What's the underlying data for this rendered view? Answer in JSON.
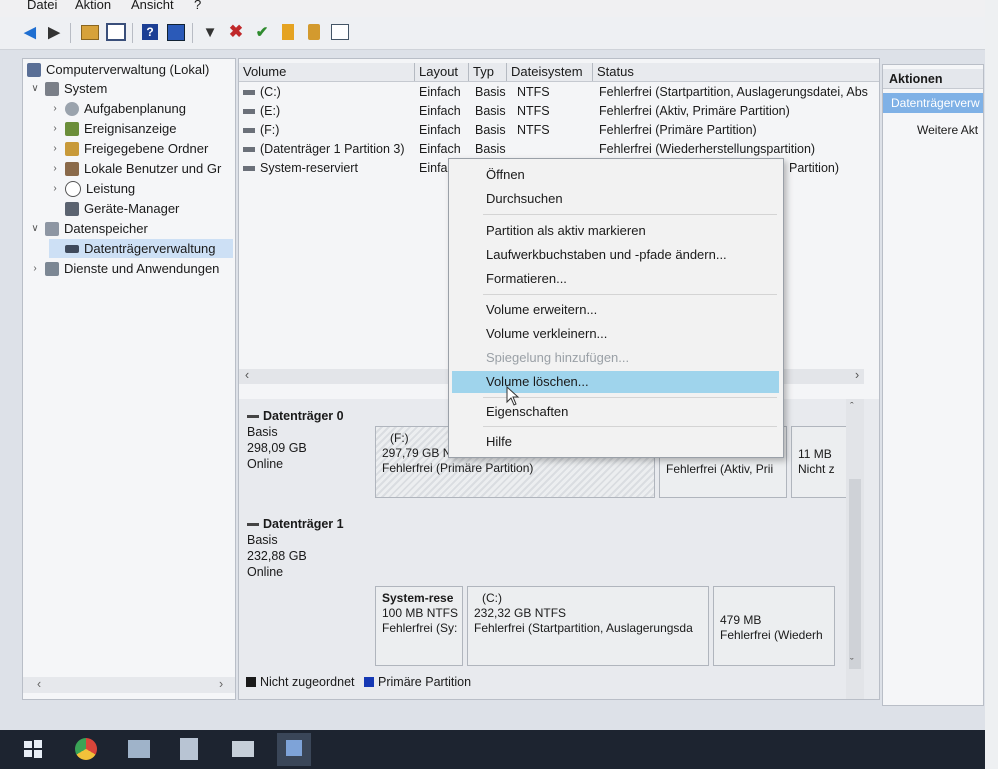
{
  "menu": [
    "Datei",
    "Aktion",
    "Ansicht",
    "?"
  ],
  "tree": {
    "root": "Computerverwaltung (Lokal)",
    "items": [
      {
        "label": "System",
        "arrow": "expanded",
        "level": 1
      },
      {
        "label": "Aufgabenplanung",
        "arrow": "collapsed",
        "level": 2
      },
      {
        "label": "Ereignisanzeige",
        "arrow": "collapsed",
        "level": 2
      },
      {
        "label": "Freigegebene Ordner",
        "arrow": "collapsed",
        "level": 2
      },
      {
        "label": "Lokale Benutzer und Gr",
        "arrow": "collapsed",
        "level": 2
      },
      {
        "label": "Leistung",
        "arrow": "collapsed",
        "level": 2
      },
      {
        "label": "Geräte-Manager",
        "arrow": "none",
        "level": 2
      },
      {
        "label": "Datenspeicher",
        "arrow": "expanded",
        "level": 1
      },
      {
        "label": "Datenträgerverwaltung",
        "arrow": "none",
        "level": 2
      },
      {
        "label": "Dienste und Anwendungen",
        "arrow": "collapsed",
        "level": 1
      }
    ]
  },
  "volume_table": {
    "headers": [
      "Volume",
      "Layout",
      "Typ",
      "Dateisystem",
      "Status"
    ],
    "rows": [
      {
        "volume": "(C:)",
        "layout": "Einfach",
        "typ": "Basis",
        "fs": "NTFS",
        "status": "Fehlerfrei (Startpartition, Auslagerungsdatei, Abs"
      },
      {
        "volume": "(E:)",
        "layout": "Einfach",
        "typ": "Basis",
        "fs": "NTFS",
        "status": "Fehlerfrei (Aktiv, Primäre Partition)"
      },
      {
        "volume": "(F:)",
        "layout": "Einfach",
        "typ": "Basis",
        "fs": "NTFS",
        "status": "Fehlerfrei (Primäre Partition)"
      },
      {
        "volume": "(Datenträger 1 Partition 3)",
        "layout": "Einfach",
        "typ": "Basis",
        "fs": "",
        "status": "Fehlerfrei (Wiederherstellungspartition)"
      },
      {
        "volume": "System-reserviert",
        "layout": "Einfa",
        "typ": "",
        "fs": "",
        "status": "Partition)"
      }
    ]
  },
  "disks": {
    "disk0": {
      "name": "Datenträger 0",
      "type": "Basis",
      "size": "298,09 GB",
      "state": "Online",
      "partitions": [
        {
          "name": "(F:)",
          "detail": "297,79 GB N",
          "status": "Fehlerfrei (Primäre Partition)"
        },
        {
          "name": "",
          "detail": "",
          "status": "Fehlerfrei (Aktiv, Prii"
        },
        {
          "name": "",
          "detail": "11 MB",
          "status": "Nicht z"
        }
      ]
    },
    "disk1": {
      "name": "Datenträger 1",
      "type": "Basis",
      "size": "232,88 GB",
      "state": "Online",
      "partitions": [
        {
          "name": "System-rese",
          "detail": "100 MB NTFS",
          "status": "Fehlerfrei (Sy:"
        },
        {
          "name": "(C:)",
          "detail": "232,32 GB NTFS",
          "status": "Fehlerfrei (Startpartition, Auslagerungsda"
        },
        {
          "name": "",
          "detail": "479 MB",
          "status": "Fehlerfrei (Wiederh"
        }
      ]
    }
  },
  "legend": {
    "unallocated": "Nicht zugeordnet",
    "primary": "Primäre Partition"
  },
  "actions": {
    "header": "Aktionen",
    "selected": "Datenträgerverw",
    "more": "Weitere Akt"
  },
  "context_menu": {
    "items": [
      {
        "label": "Öffnen",
        "state": "normal"
      },
      {
        "label": "Durchsuchen",
        "state": "normal"
      },
      {
        "label": "Partition als aktiv markieren",
        "state": "normal"
      },
      {
        "label": "Laufwerkbuchstaben und -pfade ändern...",
        "state": "normal"
      },
      {
        "label": "Formatieren...",
        "state": "normal"
      },
      {
        "label": "Volume erweitern...",
        "state": "normal"
      },
      {
        "label": "Volume verkleinern...",
        "state": "normal"
      },
      {
        "label": "Spiegelung hinzufügen...",
        "state": "disabled"
      },
      {
        "label": "Volume löschen...",
        "state": "highlighted"
      },
      {
        "label": "Eigenschaften",
        "state": "normal"
      },
      {
        "label": "Hilfe",
        "state": "normal"
      }
    ]
  },
  "colors": {
    "primary_partition": "#1538b4",
    "unallocated": "#1a1a1a",
    "menu_highlight": "#9fd4ec",
    "taskbar": "#1d2430"
  }
}
